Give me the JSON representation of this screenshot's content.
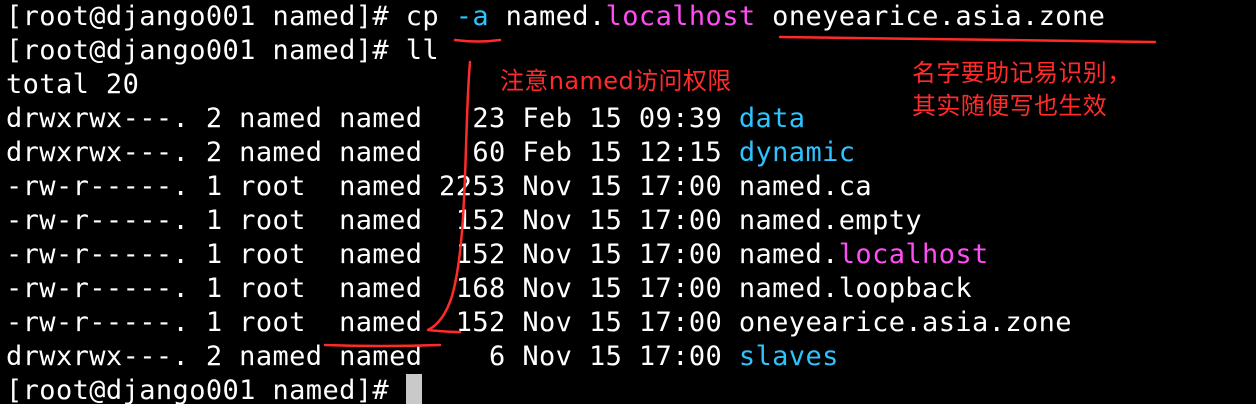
{
  "terminal": {
    "colors": {
      "background": "#000000",
      "text": "#ffffff",
      "magenta": "#ff4df4",
      "cyan": "#2ec3ff",
      "annotation": "#ff2b2b"
    },
    "lines": [
      {
        "prompt": "[root@django001 named]# ",
        "cmd": "cp ",
        "flag": "-a",
        "rest1": " named.",
        "hl": "localhost",
        "rest2": " oneyearice.asia.zone"
      },
      {
        "prompt": "[root@django001 named]# ",
        "cmd": "ll"
      },
      {
        "text": "total 20"
      },
      {
        "meta": "drwxrwx---. 2 named named   23 Feb 15 09:39 ",
        "name": "data",
        "kind": "dir"
      },
      {
        "meta": "drwxrwx---. 2 named named   60 Feb 15 12:15 ",
        "name": "dynamic",
        "kind": "dir"
      },
      {
        "meta": "-rw-r-----. 1 root  named 2253 Nov 15 17:00 ",
        "name": "named.ca",
        "kind": "file"
      },
      {
        "meta": "-rw-r-----. 1 root  named  152 Nov 15 17:00 ",
        "name": "named.empty",
        "kind": "file"
      },
      {
        "meta": "-rw-r-----. 1 root  named  152 Nov 15 17:00 ",
        "name_prefix": "named.",
        "name_hl": "localhost",
        "kind": "file-hl"
      },
      {
        "meta": "-rw-r-----. 1 root  named  168 Nov 15 17:00 ",
        "name": "named.loopback",
        "kind": "file"
      },
      {
        "meta": "-rw-r-----. 1 root  named  152 Nov 15 17:00 ",
        "name": "oneyearice.asia.zone",
        "kind": "file"
      },
      {
        "meta": "drwxrwx---. 2 named named    6 Nov 15 17:00 ",
        "name": "slaves",
        "kind": "dir"
      },
      {
        "prompt": "[root@django001 named]# "
      }
    ]
  },
  "annotations": {
    "note_permission": "注意named访问权限",
    "note_name_line1": "名字要助记易识别，",
    "note_name_line2": "其实随便写也生效"
  }
}
